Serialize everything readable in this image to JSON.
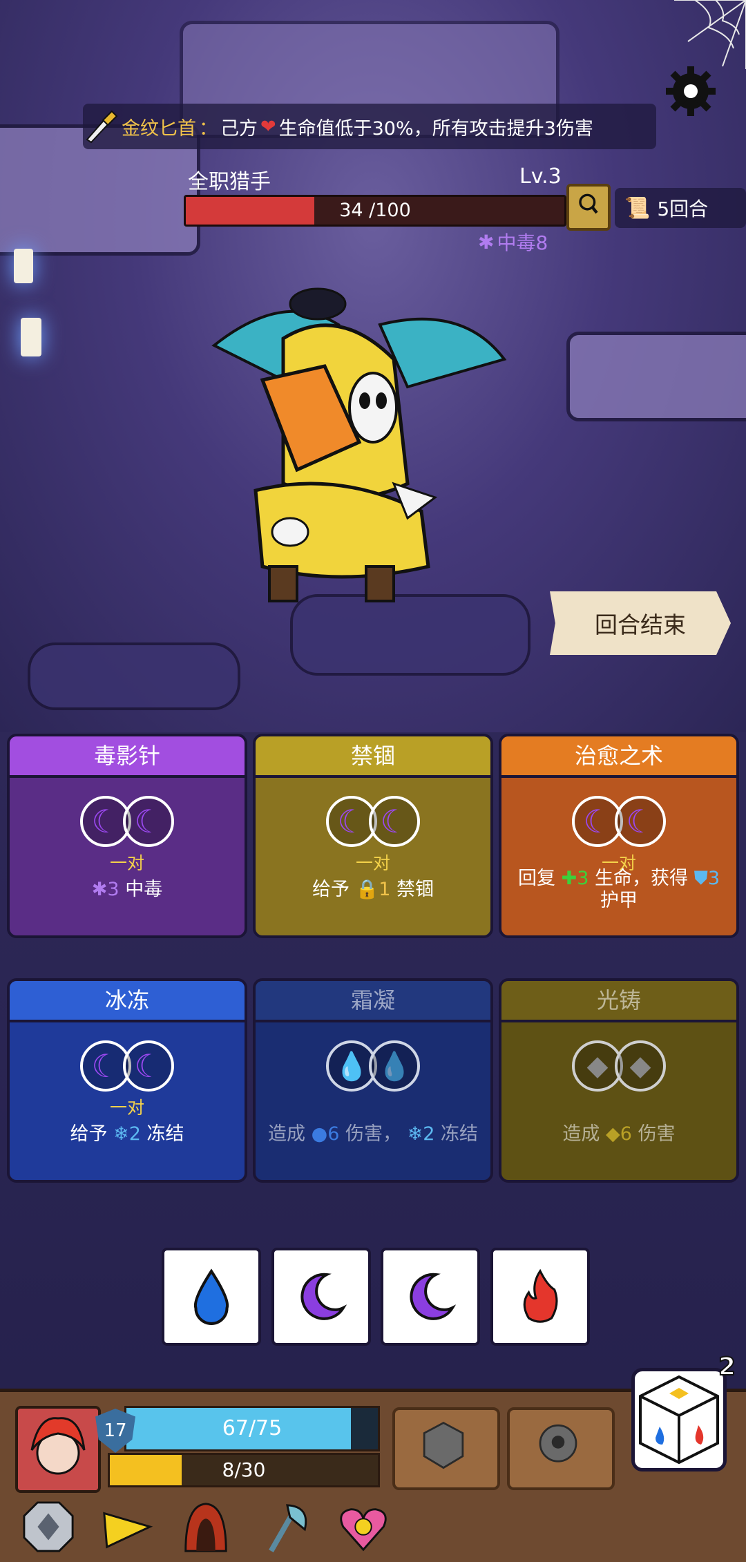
{
  "relic": {
    "name": "金纹匕首",
    "colon": "：",
    "owner": "己方",
    "description": "生命值低于30%，所有攻击提升3伤害"
  },
  "enemy": {
    "name": "全职猎手",
    "level": "Lv.3",
    "hp_text": "34 /100",
    "hp_fraction": 0.34,
    "status": "中毒8"
  },
  "turn_counter": "5回合",
  "end_turn_label": "回合结束",
  "cards": [
    {
      "title": "毒影针",
      "pair": "一对",
      "effect_value": "3",
      "effect_text": "中毒"
    },
    {
      "title": "禁锢",
      "pair": "一对",
      "effect_prefix": "给予",
      "effect_value": "1",
      "effect_text": "禁锢"
    },
    {
      "title": "治愈之术",
      "pair": "一对",
      "effect_prefix": "回复",
      "effect_value": "3",
      "effect_mid": "生命，获得",
      "effect_value2": "3",
      "effect_suffix": "护甲"
    },
    {
      "title": "冰冻",
      "pair": "一对",
      "effect_prefix": "给予",
      "effect_value": "2",
      "effect_text": "冻结"
    },
    {
      "title": "霜凝",
      "effect_prefix": "造成",
      "effect_value": "6",
      "effect_mid": "伤害，",
      "effect_value2": "2",
      "effect_text": "冻结"
    },
    {
      "title": "光铸",
      "effect_prefix": "造成",
      "effect_value": "6",
      "effect_text": "伤害"
    }
  ],
  "dice_tray": [
    "water",
    "moon",
    "moon",
    "fire"
  ],
  "player": {
    "level": "17",
    "hp_text": "67/75",
    "hp_fraction": 0.893,
    "xp_text": "8/30",
    "xp_fraction": 0.267
  },
  "reroll_count": "2",
  "colors": {
    "poison": "#b17cf0",
    "heal": "#3bd13b",
    "armor": "#5cb8f0",
    "pair_label": "#f5d34a"
  }
}
